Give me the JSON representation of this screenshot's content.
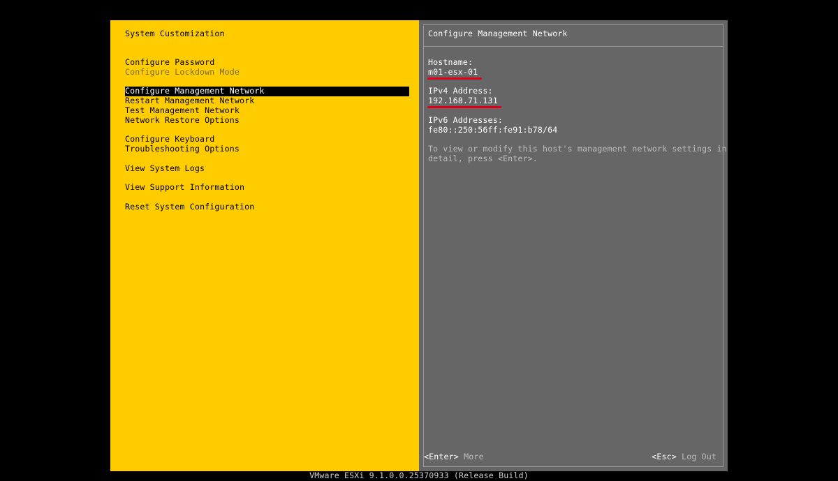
{
  "left_panel": {
    "title": "System Customization",
    "menu": [
      {
        "label": "Configure Password",
        "state": "normal"
      },
      {
        "label": "Configure Lockdown Mode",
        "state": "disabled"
      },
      {
        "label": "Configure Management Network",
        "state": "selected"
      },
      {
        "label": "Restart Management Network",
        "state": "normal"
      },
      {
        "label": "Test Management Network",
        "state": "normal"
      },
      {
        "label": "Network Restore Options",
        "state": "normal"
      },
      {
        "label": "Configure Keyboard",
        "state": "normal"
      },
      {
        "label": "Troubleshooting Options",
        "state": "normal"
      },
      {
        "label": "View System Logs",
        "state": "normal"
      },
      {
        "label": "View Support Information",
        "state": "normal"
      },
      {
        "label": "Reset System Configuration",
        "state": "normal"
      }
    ]
  },
  "right_panel": {
    "title": "Configure Management Network",
    "hostname_label": "Hostname:",
    "hostname_value": "m01-esx-01",
    "ipv4_label": "IPv4 Address:",
    "ipv4_value": "192.168.71.131",
    "ipv6_label": "IPv6 Addresses:",
    "ipv6_value": "fe80::250:56ff:fe91:b78/64",
    "hint_line1": "To view or modify this host's management network settings in",
    "hint_line2": "detail, press <Enter>."
  },
  "footer": {
    "enter_key": "<Enter>",
    "enter_action": "More",
    "esc_key": "<Esc>",
    "esc_action": "Log Out"
  },
  "status_bar": {
    "build": "VMware ESXi 9.1.0.0.25370933 (Release Build)"
  },
  "colors": {
    "left_background": "#ffcc00",
    "right_background": "#666666",
    "selection": "#000000",
    "annotation_underline": "#e0001b"
  }
}
